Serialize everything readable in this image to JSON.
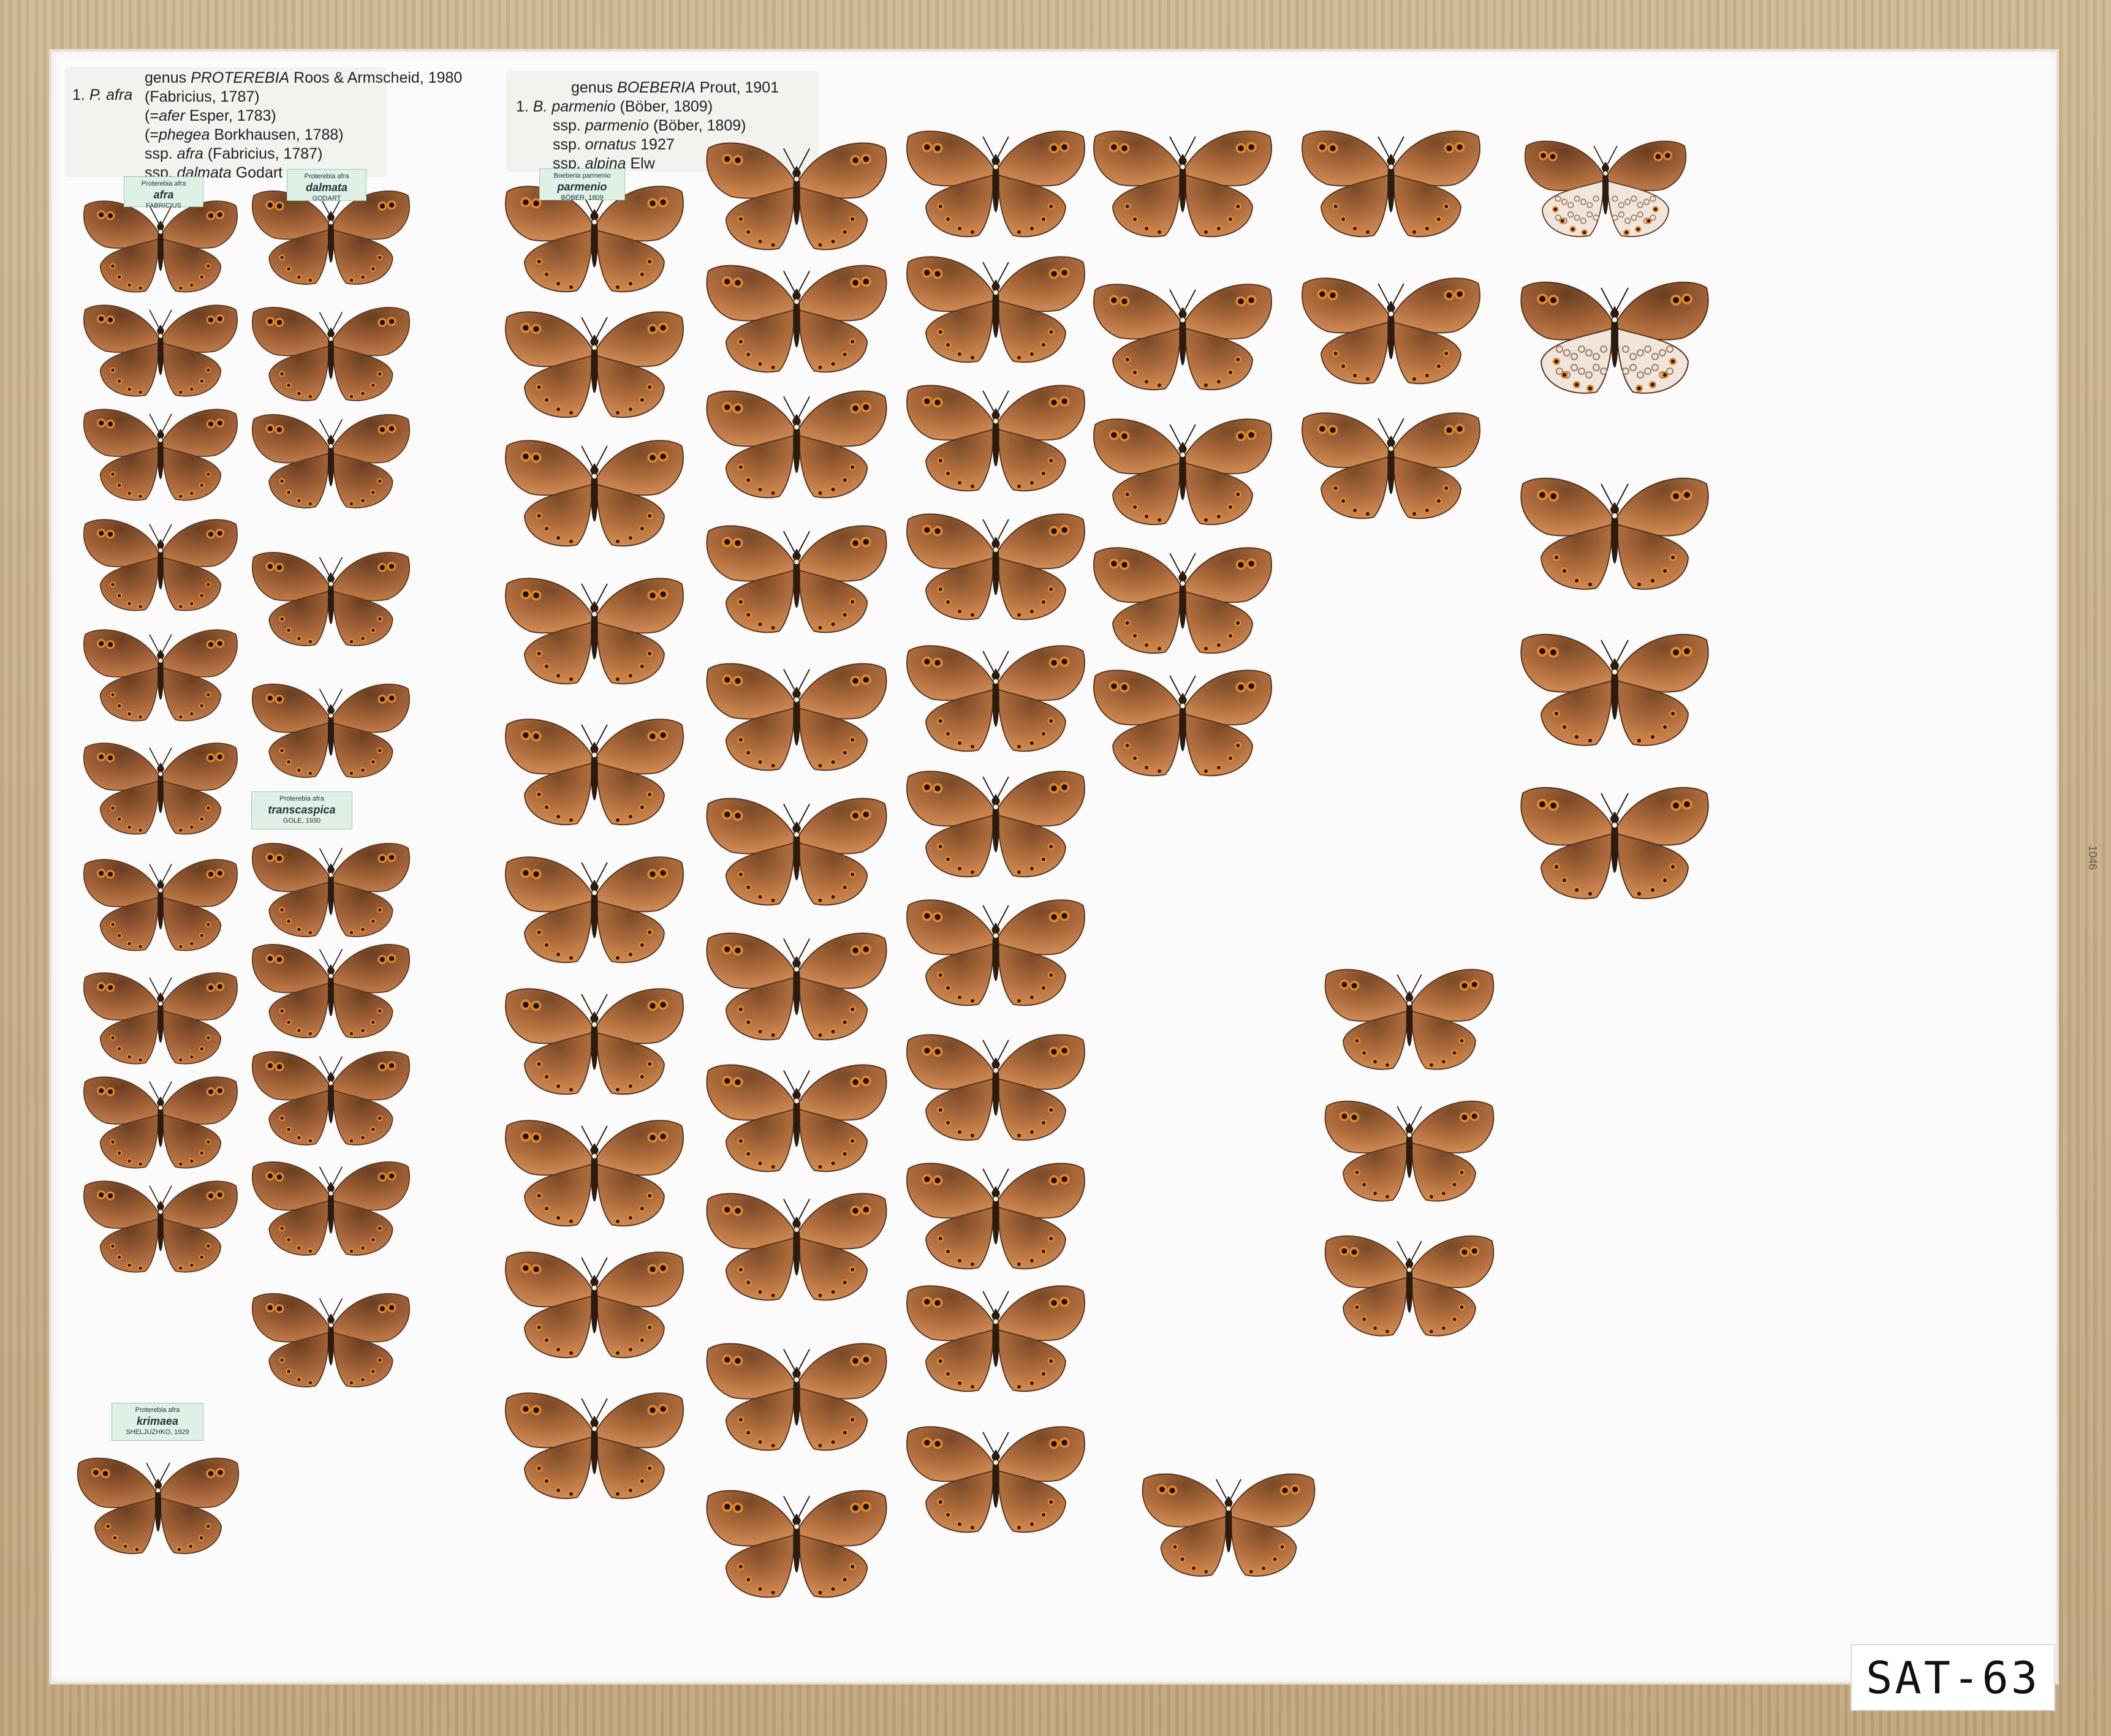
{
  "labels": {
    "proterebia": {
      "number": "1.",
      "species": "P. afra",
      "line1_prefix": "genus ",
      "genus": "PROTEREBIA",
      "line1_author": " Roos & Armscheid, 1980",
      "line2": "(Fabricius, 1787)",
      "line3_open": "(=",
      "line3_italic": "afer",
      "line3_rest": " Esper, 1783)",
      "line4_open": "(=",
      "line4_italic": "phegea",
      "line4_rest": " Borkhausen, 1788)",
      "line5_prefix": "ssp. ",
      "line5_italic": "afra",
      "line5_rest": " (Fabricius, 1787)",
      "line6_prefix": "ssp. ",
      "line6_italic": "dalmata",
      "line6_rest": " Godart"
    },
    "boeberia": {
      "line1_prefix": "genus ",
      "genus": "BOEBERIA",
      "line1_author": "  Prout, 1901",
      "line2_prefix": "1. ",
      "line2_italic": "B. parmenio",
      "line2_rest": " (Böber, 1809)",
      "line3_prefix": "ssp. ",
      "line3_italic": "parmenio",
      "line3_rest": " (Böber, 1809)",
      "line4_prefix": "ssp. ",
      "line4_italic": "ornatus",
      "line4_rest": " 1927",
      "line5_prefix": "ssp. ",
      "line5_italic": "alpina",
      "line5_rest": " Elw"
    }
  },
  "tags": [
    {
      "genus": "Proterebia afra",
      "species": "afra",
      "author": "FABRICIUS"
    },
    {
      "genus": "Proterebia afra",
      "species": "dalmata",
      "author": "GODART"
    },
    {
      "genus": "Boeberia parmenio",
      "species": "parmenio",
      "author": "BÖBER, 1809"
    },
    {
      "genus": "Proterebia afra",
      "species": "transcaspica",
      "author": "GOLE, 1930"
    },
    {
      "genus": "Proterebia afra",
      "species": "krimaea",
      "author": "SHELJUZHKO, 1929"
    }
  ],
  "catalog": "SAT-63",
  "side_stamp": "1046",
  "colors": {
    "wing_dark": "#6a3f22",
    "wing_mid": "#9b5d34",
    "wing_light": "#c07b49",
    "body": "#2b1c12",
    "board": "#fbfbfb",
    "frame": "#c6ae86",
    "ocelli": "#e0862b"
  }
}
